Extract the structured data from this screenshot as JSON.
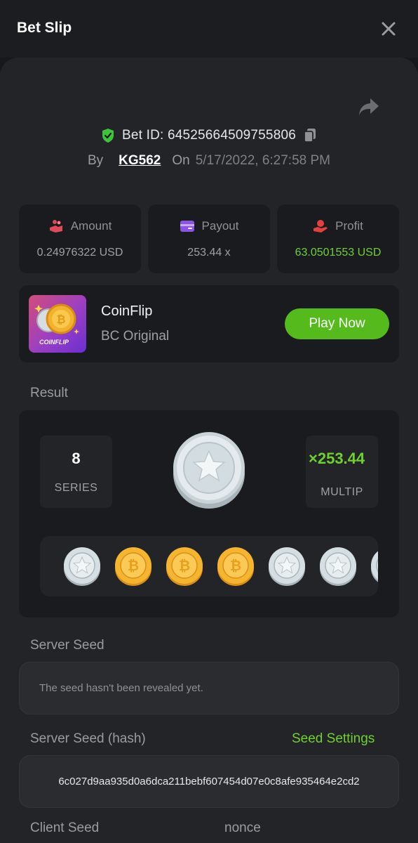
{
  "header": {
    "title": "Bet Slip"
  },
  "bet": {
    "id_text": "Bet ID: 64525664509755806",
    "by_label": "By",
    "user": "KG562",
    "on_label": "On",
    "datetime": "5/17/2022, 6:27:58 PM"
  },
  "stats": {
    "amount_label": "Amount",
    "amount_value": "0.24976322 USD",
    "payout_label": "Payout",
    "payout_value": "253.44 x",
    "profit_label": "Profit",
    "profit_value": "63.0501553 USD"
  },
  "game": {
    "thumb_text": "COINFLIP",
    "name": "CoinFlip",
    "subtitle": "BC Original",
    "play_label": "Play Now"
  },
  "result": {
    "label": "Result",
    "series_num": "8",
    "series_label": "SERIES",
    "multiplier": "×253.44",
    "multiplier_label": "MULTIP",
    "coins": [
      "silver",
      "gold",
      "gold",
      "gold",
      "silver",
      "silver",
      "silver"
    ]
  },
  "server_seed": {
    "label": "Server Seed",
    "value": "The seed hasn't been revealed yet."
  },
  "server_hash": {
    "label": "Server Seed (hash)",
    "settings_link": "Seed Settings",
    "value": "6c027d9aa935d0a6dca211bebf607454d07e0c8afe935464e2cd2"
  },
  "client": {
    "seed_label": "Client Seed",
    "nonce_label": "nonce"
  },
  "colors": {
    "accent_green": "#55bb1c",
    "profit_green": "#6fd12e",
    "background": "#17181b",
    "panel": "#232427",
    "card": "#1a1b1e"
  }
}
